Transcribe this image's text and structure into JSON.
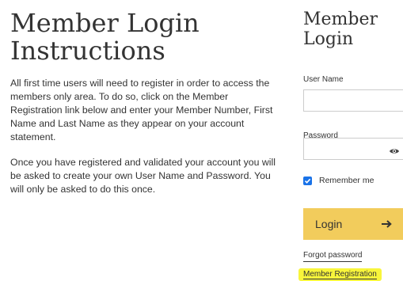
{
  "instructions": {
    "title": "Member Login Instructions",
    "paragraph1": "All first time users will need to register in order to access the members only area. To do so, click on the Member Registration link below and enter your Member Number, First Name and Last Name as they appear on your account statement.",
    "paragraph2": "Once you have registered and validated your account you will be asked to create your own User Name and Password. You will only be asked to do this once."
  },
  "login": {
    "title": "Member Login",
    "username_label": "User Name",
    "username_value": "",
    "password_label": "Password",
    "password_value": "",
    "remember_label": "Remember me",
    "remember_checked": true,
    "login_button": "Login",
    "forgot_password": "Forgot password",
    "member_registration": "Member Registration"
  },
  "colors": {
    "button": "#f2cc5c",
    "highlight": "#f8f53b",
    "checkbox": "#1a73e8",
    "text": "#333333"
  },
  "icons": {
    "password_toggle": "eye-icon",
    "login_arrow": "arrow-right-icon",
    "remember_checkbox": "checkmark-icon"
  }
}
